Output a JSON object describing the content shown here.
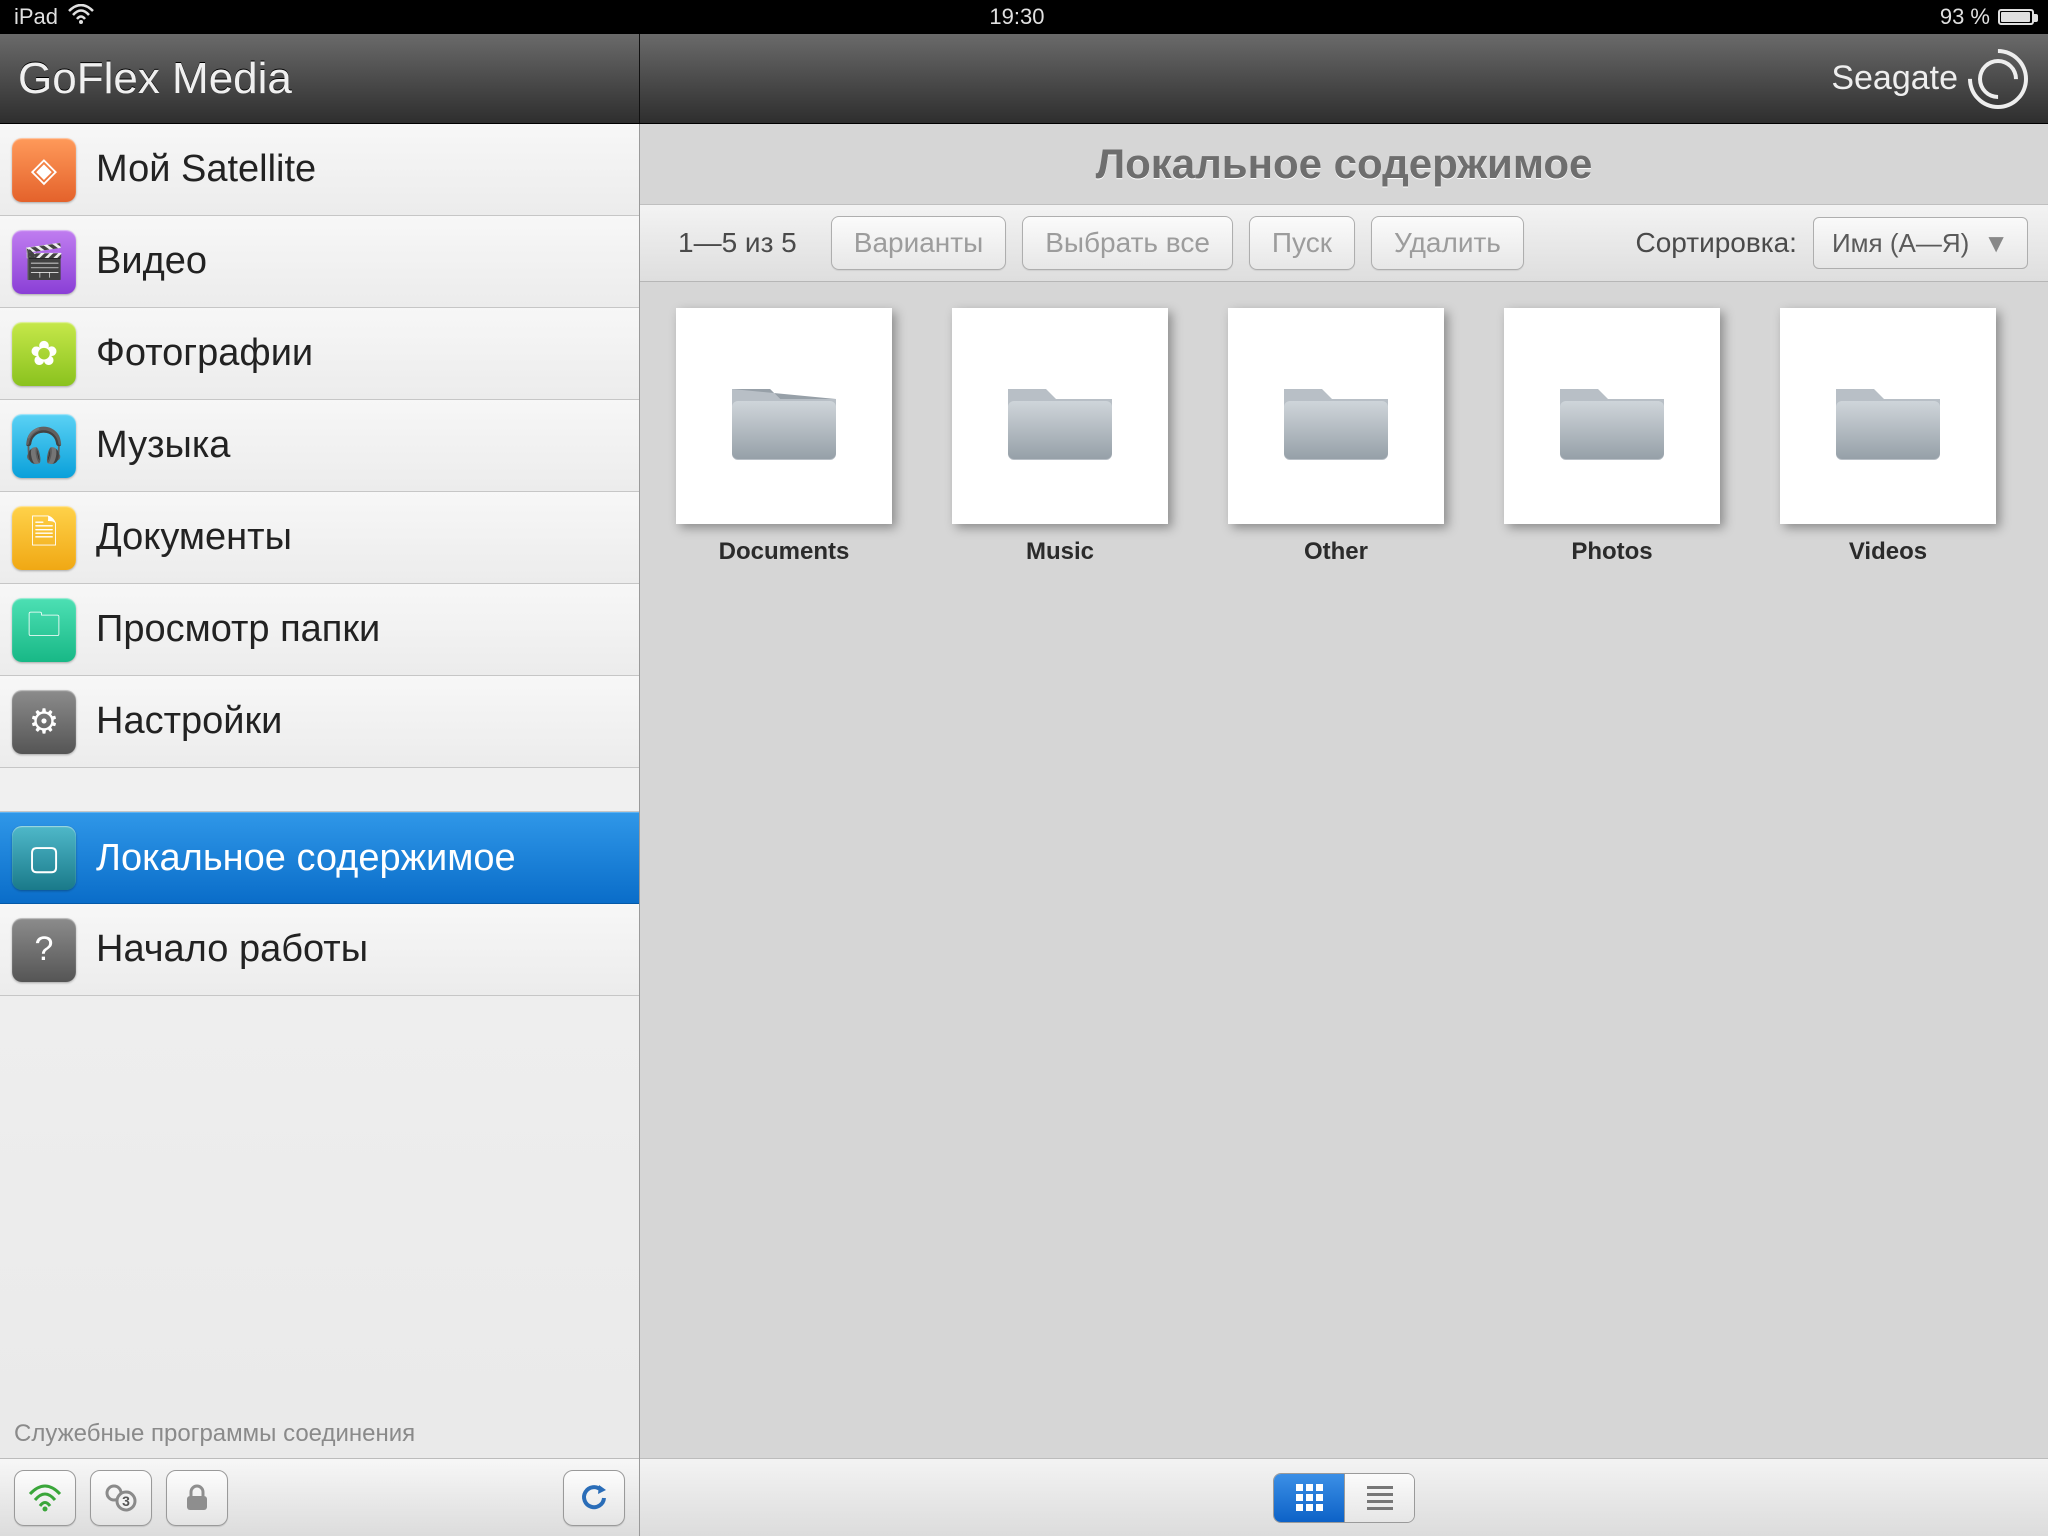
{
  "statusbar": {
    "device": "iPad",
    "time": "19:30",
    "battery_text": "93 %"
  },
  "header": {
    "app_title": "GoFlex Media",
    "brand": "Seagate"
  },
  "sidebar": {
    "items": [
      {
        "label": "Мой Satellite",
        "icon": "satellite"
      },
      {
        "label": "Видео",
        "icon": "video"
      },
      {
        "label": "Фотографии",
        "icon": "photos"
      },
      {
        "label": "Музыка",
        "icon": "music"
      },
      {
        "label": "Документы",
        "icon": "documents"
      },
      {
        "label": "Просмотр папки",
        "icon": "folder"
      },
      {
        "label": "Настройки",
        "icon": "settings"
      },
      {
        "label": "Локальное содержимое",
        "icon": "local"
      },
      {
        "label": "Начало работы",
        "icon": "help"
      }
    ],
    "selected_index": 7,
    "footer_caption": "Служебные программы соединения",
    "footer_badge": "3"
  },
  "content": {
    "title": "Локальное содержимое",
    "count_text": "1—5 из 5",
    "buttons": {
      "variants": "Варианты",
      "select_all": "Выбрать все",
      "play": "Пуск",
      "delete": "Удалить"
    },
    "sort_label": "Сортировка:",
    "sort_value": "Имя (А—Я)",
    "folders": [
      {
        "name": "Documents"
      },
      {
        "name": "Music"
      },
      {
        "name": "Other"
      },
      {
        "name": "Photos"
      },
      {
        "name": "Videos"
      }
    ]
  }
}
